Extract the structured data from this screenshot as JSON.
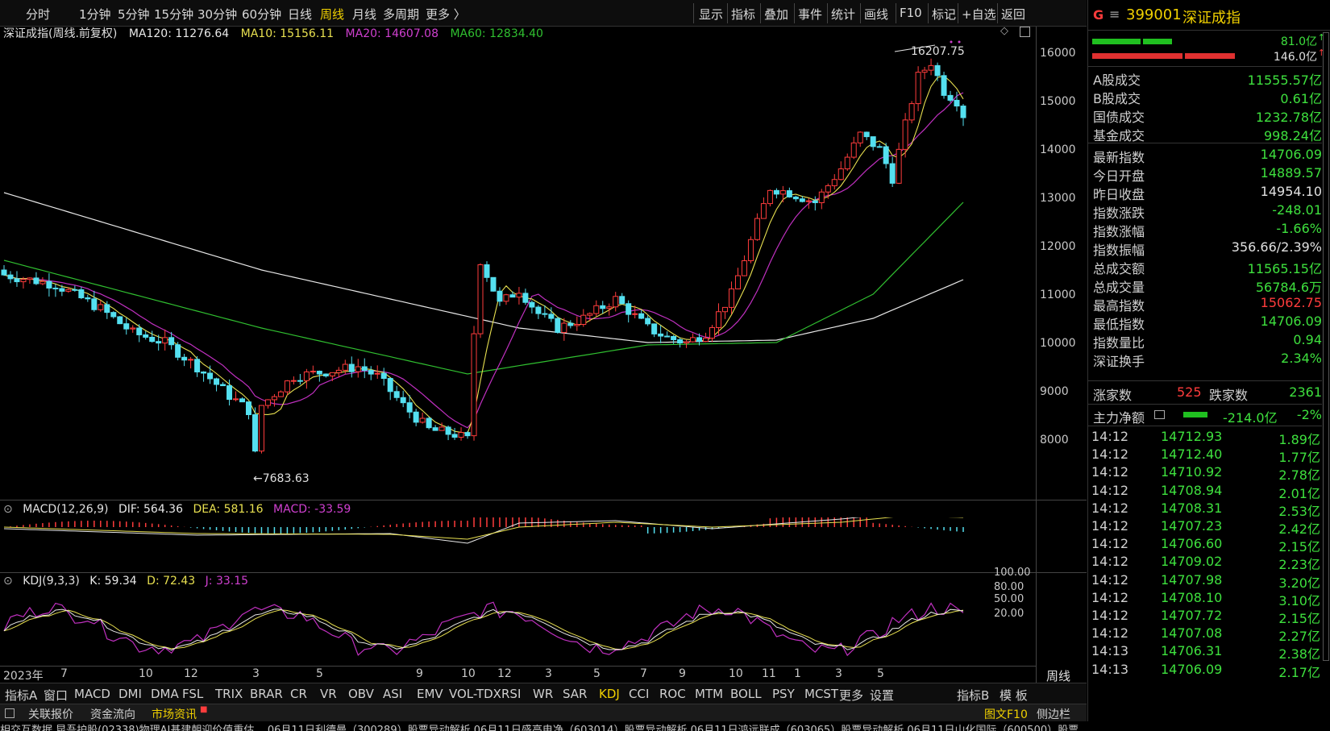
{
  "toolbar": {
    "periods": [
      "分时",
      "1分钟",
      "5分钟",
      "15分钟",
      "30分钟",
      "60分钟",
      "日线",
      "周线",
      "月线",
      "多周期",
      "更多 〉"
    ],
    "active_period": "周线",
    "tools": [
      "显示",
      "指标",
      "叠加",
      "事件",
      "统计",
      "画线",
      "F10",
      "标记",
      "+自选",
      "返回"
    ]
  },
  "chart_info": {
    "title": "深证成指(周线.前复权)",
    "ma120": "MA120: 11276.64",
    "ma10": "MA10: 15156.11",
    "ma20": "MA20: 14607.08",
    "ma60": "MA60: 12834.40"
  },
  "price_axis": [
    "16000",
    "15000",
    "14000",
    "13000",
    "12000",
    "11000",
    "10000",
    "9000",
    "8000"
  ],
  "annotations": {
    "high": "16207.75",
    "low": "7683.63"
  },
  "macd": {
    "label": "MACD(12,26,9)",
    "dif": "DIF: 564.36",
    "dea": "DEA: 581.16",
    "macd": "MACD: -33.59"
  },
  "kdj": {
    "label": "KDJ(9,3,3)",
    "k": "K: 59.34",
    "d": "D: 72.43",
    "j": "J: 33.15",
    "axis": [
      "100.00",
      "80.00",
      "50.00",
      "20.00"
    ]
  },
  "date_axis": [
    "2023年",
    "7",
    "10",
    "12",
    "3",
    "5",
    "9",
    "10",
    "12",
    "3",
    "5",
    "7",
    "9",
    "10",
    "11",
    "1",
    "3",
    "5"
  ],
  "indicator_tabs": [
    "指标A",
    "窗口",
    "MACD",
    "DMI",
    "DMA",
    "FSL",
    "TRIX",
    "BRAR",
    "CR",
    "VR",
    "OBV",
    "ASI",
    "EMV",
    "VOL-TDX",
    "RSI",
    "WR",
    "SAR",
    "KDJ",
    "CCI",
    "ROC",
    "MTM",
    "BOLL",
    "PSY",
    "MCST",
    "更多",
    "设置"
  ],
  "active_indicator": "KDJ",
  "indicator_right": [
    "指标B",
    "模 板"
  ],
  "period_label": "周线",
  "link_bar": {
    "related": "关联报价",
    "flow": "资金流向",
    "news": "市场资讯",
    "f10": "图文F10",
    "sidebar": "侧边栏"
  },
  "ticker": "相交互数据 昆吾护股(02338)物理AI基建朝迎价值重估...     06月11日利德曼（300289）股票异动解析     06月11日盛高电净（603014）股票异动解析     06月11日鸿远联成（603065）股票异动解析     06月11日山化国际（600500）股票...",
  "panel": {
    "code": "399001",
    "name": "深证成指",
    "buy_amount": "81.0亿",
    "sell_amount": "146.0亿",
    "stats": [
      {
        "k": "A股成交",
        "v": "11555.57亿",
        "c": "#3ee03e"
      },
      {
        "k": "B股成交",
        "v": "0.61亿",
        "c": "#3ee03e"
      },
      {
        "k": "国债成交",
        "v": "1232.78亿",
        "c": "#3ee03e"
      },
      {
        "k": "基金成交",
        "v": "998.24亿",
        "c": "#3ee03e"
      },
      {
        "k": "最新指数",
        "v": "14706.09",
        "c": "#3ee03e"
      },
      {
        "k": "今日开盘",
        "v": "14889.57",
        "c": "#3ee03e"
      },
      {
        "k": "昨日收盘",
        "v": "14954.10",
        "c": "#e0e0e0"
      },
      {
        "k": "指数涨跌",
        "v": "-248.01",
        "c": "#3ee03e"
      },
      {
        "k": "指数涨幅",
        "v": "-1.66%",
        "c": "#3ee03e"
      },
      {
        "k": "指数振幅",
        "v": "356.66/2.39%",
        "c": "#e0e0e0"
      },
      {
        "k": "总成交额",
        "v": "11565.15亿",
        "c": "#3ee03e"
      },
      {
        "k": "总成交量",
        "v": "56784.6万",
        "c": "#3ee03e"
      },
      {
        "k": "最高指数",
        "v": "15062.75",
        "c": "#ff3c3c"
      },
      {
        "k": "最低指数",
        "v": "14706.09",
        "c": "#3ee03e"
      },
      {
        "k": "指数量比",
        "v": "0.94",
        "c": "#3ee03e"
      },
      {
        "k": "深证换手",
        "v": "2.34%",
        "c": "#3ee03e"
      }
    ],
    "up_label": "涨家数",
    "up_count": "525",
    "down_label": "跌家数",
    "down_count": "2361",
    "main_flow_label": "主力净额",
    "main_flow_value": "-214.0亿",
    "main_flow_pct": "-2%",
    "ticks": [
      {
        "t": "14:12",
        "p": "14712.93",
        "r": "1.89亿"
      },
      {
        "t": "14:12",
        "p": "14712.40",
        "r": "1.77亿"
      },
      {
        "t": "14:12",
        "p": "14710.92",
        "r": "2.78亿"
      },
      {
        "t": "14:12",
        "p": "14708.94",
        "r": "2.01亿"
      },
      {
        "t": "14:12",
        "p": "14708.31",
        "r": "2.53亿"
      },
      {
        "t": "14:12",
        "p": "14707.23",
        "r": "2.42亿"
      },
      {
        "t": "14:12",
        "p": "14706.60",
        "r": "2.15亿"
      },
      {
        "t": "14:12",
        "p": "14709.02",
        "r": "2.23亿"
      },
      {
        "t": "14:12",
        "p": "14707.98",
        "r": "3.20亿"
      },
      {
        "t": "14:12",
        "p": "14708.10",
        "r": "3.10亿"
      },
      {
        "t": "14:12",
        "p": "14707.72",
        "r": "2.15亿"
      },
      {
        "t": "14:12",
        "p": "14707.08",
        "r": "2.27亿"
      },
      {
        "t": "14:13",
        "p": "14706.31",
        "r": "2.38亿"
      },
      {
        "t": "14:13",
        "p": "14706.09",
        "r": "2.17亿"
      }
    ]
  },
  "colors": {
    "up": "#ff3c3c",
    "down": "#54e0f0",
    "ma10": "#e8e050",
    "ma20": "#c030c0",
    "ma60": "#30c030",
    "ma120": "#e8e8e8",
    "active": "#f0d000"
  }
}
